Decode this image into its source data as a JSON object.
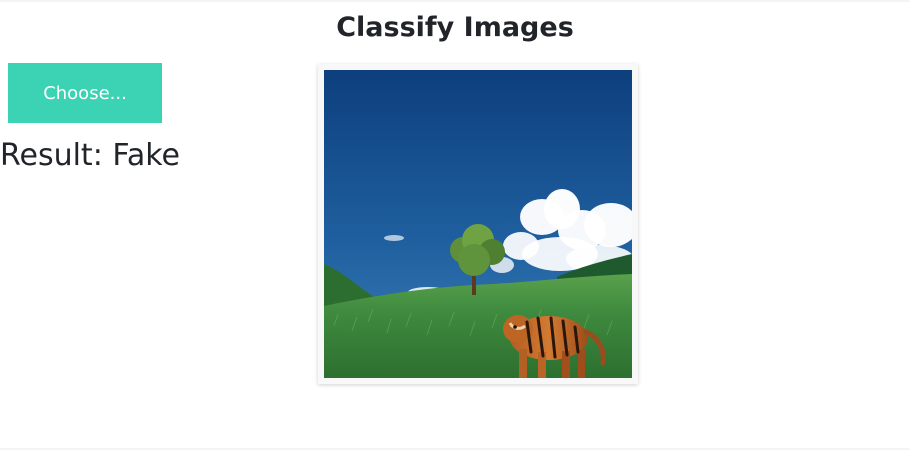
{
  "header": {
    "title": "Classify Images"
  },
  "controls": {
    "choose_label": "Choose..."
  },
  "result": {
    "text": "Result: Fake"
  },
  "preview": {
    "subject": "tiger in grassy field with tree and clouds"
  },
  "colors": {
    "accent": "#3cd3b5",
    "text": "#212529",
    "sky_top": "#0d3f7d",
    "sky_bottom": "#2d73ad",
    "grass": "#3f8b3f"
  }
}
